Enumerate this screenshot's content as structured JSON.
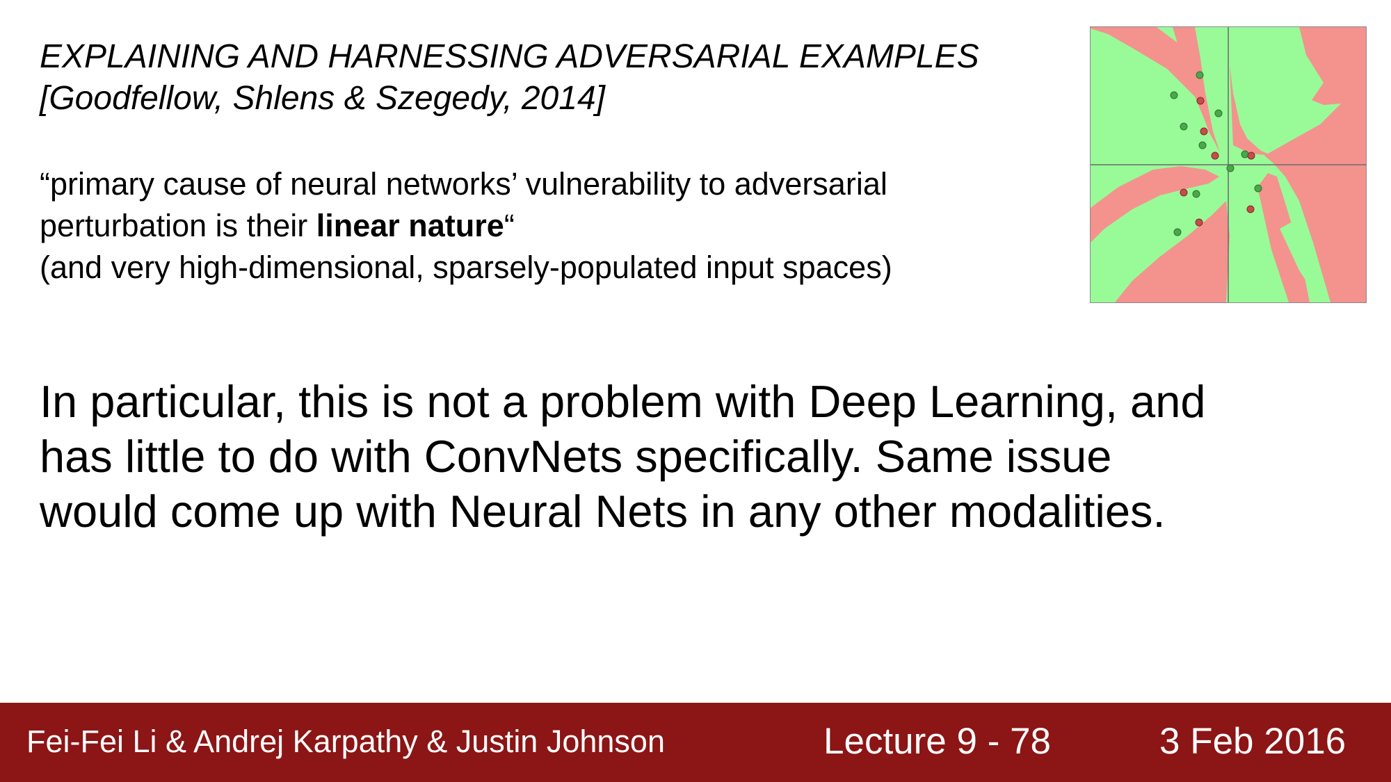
{
  "slide": {
    "citation": {
      "title": "EXPLAINING AND HARNESSING ADVERSARIAL EXAMPLES",
      "authors": "[Goodfellow, Shlens & Szegedy, 2014]"
    },
    "quote": {
      "line1": "“primary cause of neural networks’ vulnerability to adversarial",
      "line2_before": "perturbation is their ",
      "line2_bold": "linear nature",
      "line2_after": "“",
      "line3": "(and very high-dimensional, sparsely-populated input spaces)"
    },
    "statement": {
      "line1": "In particular, this is not a problem with Deep Learning, and",
      "line2": "has little to do with ConvNets specifically. Same issue",
      "line3": "would come up with Neural Nets in any other modalities."
    }
  },
  "figure": {
    "kind": "2-D decision boundary of a small neural net with green and red class regions and data points",
    "colors": {
      "green_region": "#98fb98",
      "red_region": "#f4928e",
      "axis": "#6b6b6b",
      "green_point": "#4aa84a",
      "red_point": "#c94b4b"
    }
  },
  "footer": {
    "authors": "Fei-Fei Li & Andrej Karpathy & Justin Johnson",
    "lecture": "Lecture 9 - 78",
    "date": "3 Feb 2016",
    "background": "#8c1515"
  }
}
